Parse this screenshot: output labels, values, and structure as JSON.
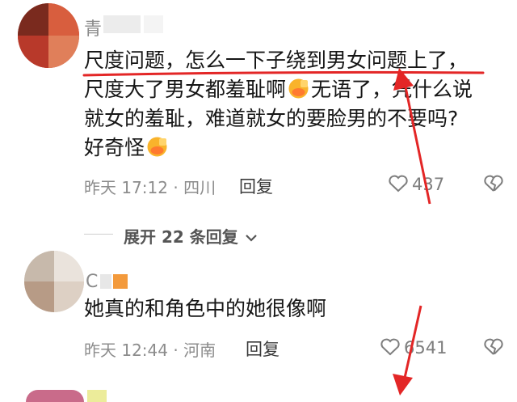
{
  "comments": [
    {
      "username": "青",
      "lines": [
        "尺度问题，怎么一下子绕到男女问题上了，",
        "尺度大了男女都羞耻啊",
        "无语了，凭什么说",
        "就女的羞耻，难道就女的要脸男的不要吗?",
        "好奇怪"
      ],
      "meta": "昨天 17:12 · 四川",
      "reply_label": "回复",
      "likes": "437"
    },
    {
      "username": "C",
      "lines": [
        "她真的和角色中的她很像啊"
      ],
      "meta": "昨天 12:44 · 河南",
      "reply_label": "回复",
      "likes": "6541"
    }
  ],
  "expand_replies": "展开 22 条回复",
  "icons": [
    "heart-outline-icon",
    "heart-broken-icon",
    "chevron-down-icon",
    "facepalm-emoji-icon"
  ],
  "colors": {
    "annotation_red": "#e32626",
    "meta_gray": "#8c8c8c"
  }
}
